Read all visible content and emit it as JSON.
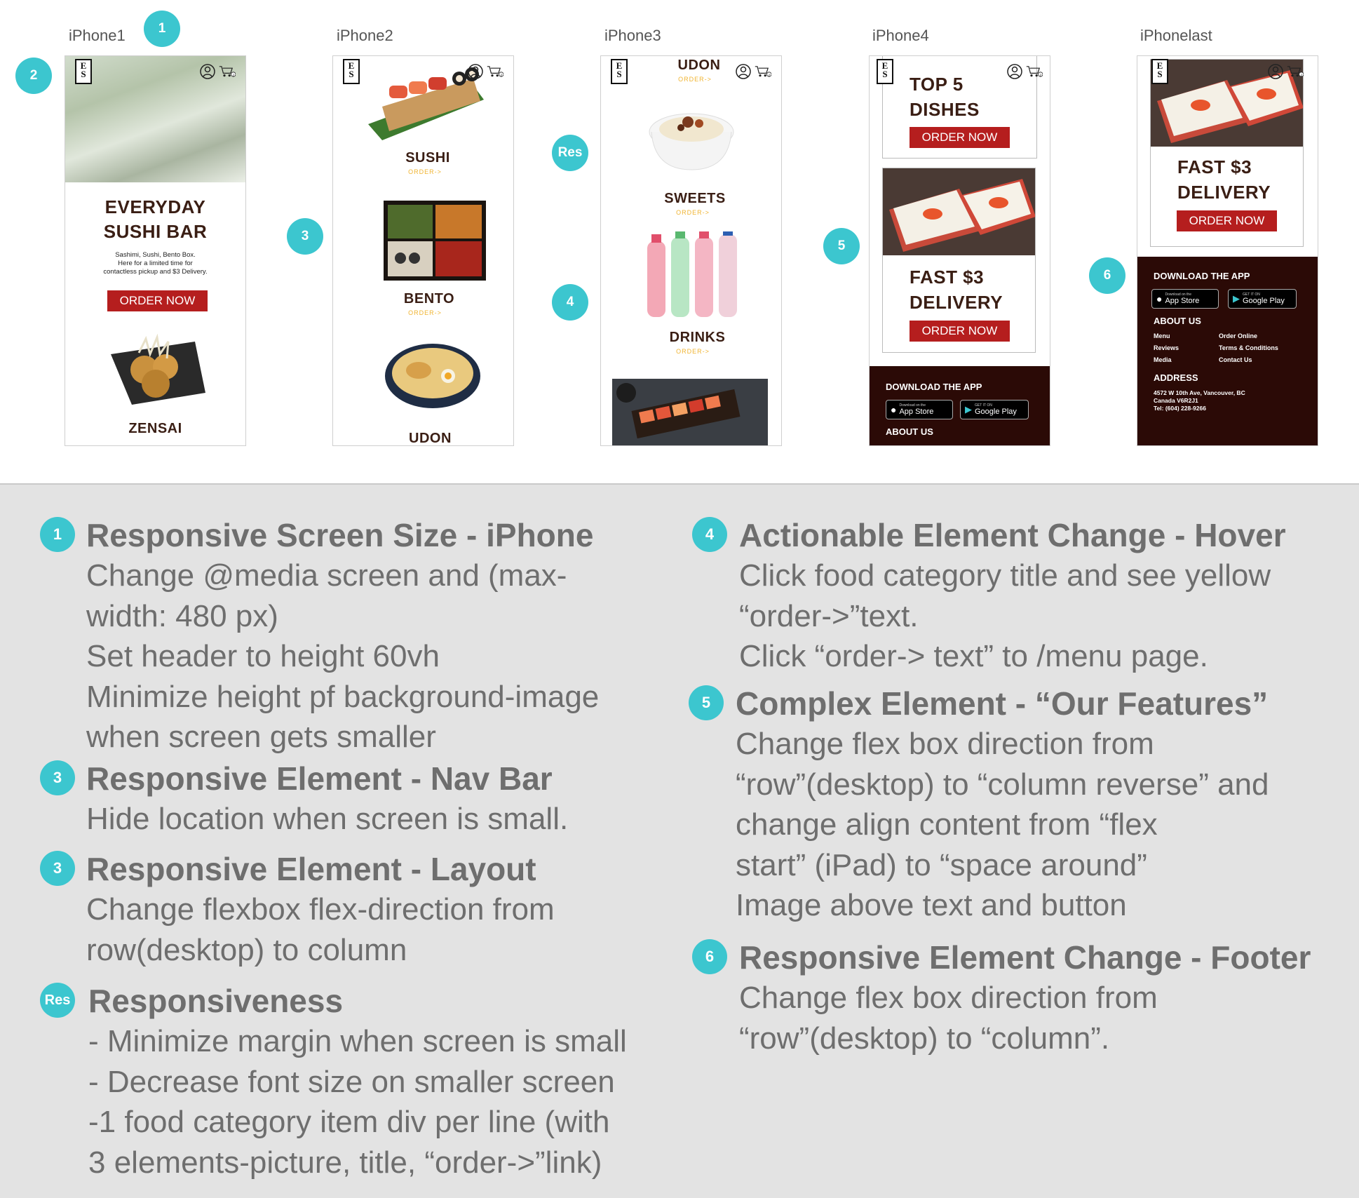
{
  "frames": [
    {
      "label": "iPhone1",
      "badge": "1"
    },
    {
      "label": "iPhone2"
    },
    {
      "label": "iPhone3"
    },
    {
      "label": "iPhone4"
    },
    {
      "label": "iPhonelast"
    }
  ],
  "canvas_badges": {
    "b2": "2",
    "b3": "3",
    "bres": "Res",
    "b4": "4",
    "b5": "5",
    "b6": "6"
  },
  "header": {
    "logo": "E S B",
    "cart_count": "2"
  },
  "phone1": {
    "hero_title": "EVERYDAY\nSUSHI BAR",
    "hero_sub": "Sashimi, Sushi, Bento Box.\nHere for a limited time for\ncontactless pickup and $3 Delivery.",
    "order_button": "ORDER NOW",
    "zensai": "ZENSAI"
  },
  "phone2": {
    "sushi": "SUSHI",
    "sushi_order": "ORDER->",
    "bento": "BENTO",
    "bento_order": "ORDER->",
    "udon": "UDON"
  },
  "phone3": {
    "udon": "UDON",
    "udon_order": "ORDER->",
    "sweets": "SWEETS",
    "sweets_order": "ORDER->",
    "drinks": "DRINKS",
    "drinks_order": "ORDER->"
  },
  "phone4": {
    "top5": "TOP 5\nDISHES",
    "order1": "ORDER NOW",
    "fast": "FAST $3\nDELIVERY",
    "order2": "ORDER NOW",
    "download": "DOWNLOAD THE APP",
    "appstore_small": "Download on the",
    "appstore": "App Store",
    "google_small": "GET IT ON",
    "google": "Google Play",
    "about": "ABOUT US"
  },
  "phone5": {
    "fast": "FAST $3\nDELIVERY",
    "order": "ORDER NOW",
    "download": "DOWNLOAD THE APP",
    "appstore_small": "Download on the",
    "appstore": "App Store",
    "google_small": "GET IT ON",
    "google": "Google Play",
    "about": "ABOUT US",
    "links": [
      "Menu",
      "Order Online",
      "Reviews",
      "Terms & Conditions",
      "Media",
      "Contact Us"
    ],
    "address_title": "ADDRESS",
    "address": "4572 W 10th Ave, Vancouver, BC\nCanada V6R2J1\nTel: (604) 228-9266"
  },
  "notes": {
    "n1": {
      "badge": "1",
      "title": "Responsive Screen Size - iPhone",
      "body": "Change @media screen and (max-\nwidth: 480 px)\nSet header to height 60vh\nMinimize height pf background-image\nwhen screen gets smaller"
    },
    "n3a": {
      "badge": "3",
      "title": "Responsive Element - Nav Bar",
      "body": "Hide location when screen is small."
    },
    "n3b": {
      "badge": "3",
      "title": "Responsive Element - Layout",
      "body": "Change flexbox flex-direction from\nrow(desktop) to column"
    },
    "nres": {
      "badge": "Res",
      "title": "Responsiveness",
      "body": "- Minimize margin when screen is small\n- Decrease font size on smaller screen\n-1 food category item div per line (with\n3 elements-picture, title, “order->”link)"
    },
    "n4": {
      "badge": "4",
      "title": "Actionable Element Change - Hover",
      "body": "Click food category title and see yellow\n“order->”text.\nClick “order-> text” to /menu page."
    },
    "n5": {
      "badge": "5",
      "title": "Complex Element - “Our Features”",
      "body": "Change flex box direction from\n“row”(desktop) to “column reverse” and\nchange align content from “flex\nstart” (iPad) to “space around”\nImage above text and button"
    },
    "n6": {
      "badge": "6",
      "title": "Responsive Element Change - Footer",
      "body": "Change flex box direction from\n“row”(desktop) to “column”."
    }
  },
  "colors": {
    "accent": "#3cc6cf",
    "brand_red": "#b51e1e",
    "footer": "#2b0a06",
    "order_yellow": "#f0b431"
  }
}
